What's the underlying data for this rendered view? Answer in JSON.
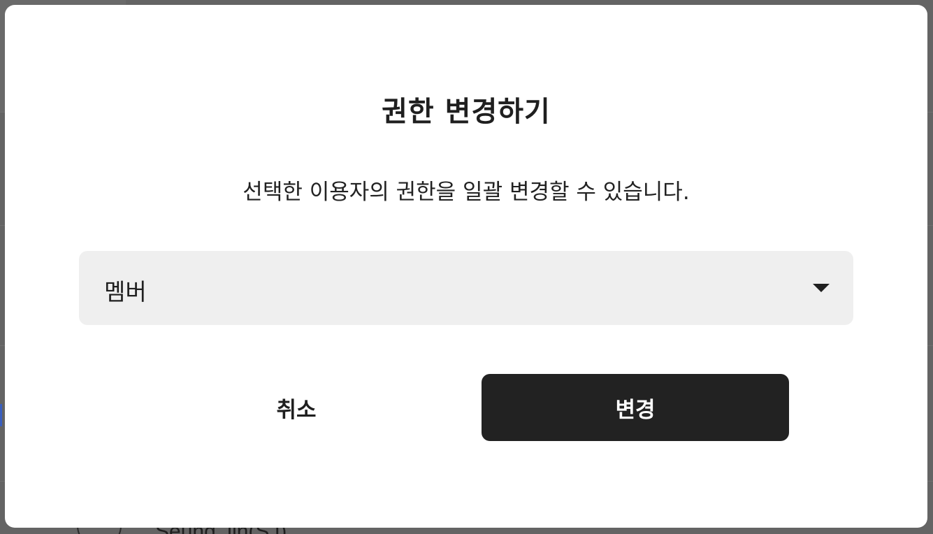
{
  "background": {
    "partial_name": "Seung Jin(SJ)"
  },
  "dialog": {
    "title": "권한 변경하기",
    "description": "선택한 이용자의 권한을 일괄 변경할 수 있습니다.",
    "role_select": {
      "selected": "멤버",
      "icon": "chevron-down-icon"
    },
    "cancel_label": "취소",
    "confirm_label": "변경"
  },
  "colors": {
    "overlay": "#646464",
    "dialog_bg": "#ffffff",
    "select_bg": "#efefef",
    "primary_button": "#222222",
    "primary_text": "#ffffff",
    "text": "#1f1f1f"
  }
}
